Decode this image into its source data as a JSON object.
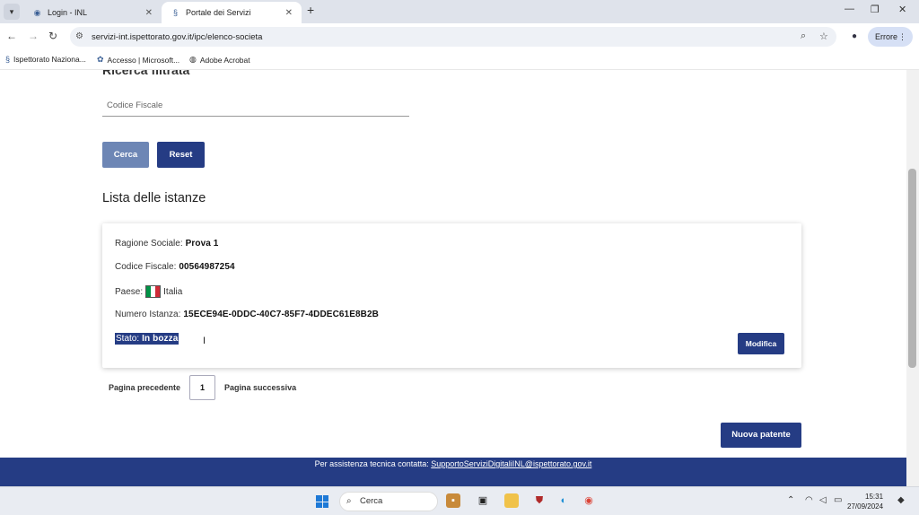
{
  "browser": {
    "tabs": [
      {
        "label": "Login - INL",
        "active": false
      },
      {
        "label": "Portale dei Servizi",
        "active": true
      }
    ],
    "url": "servizi-int.ispettorato.gov.it/ipc/elenco-societa",
    "profile_button": "Errore",
    "bookmarks": [
      {
        "label": "Ispettorato Naziona..."
      },
      {
        "label": "Accesso | Microsoft..."
      },
      {
        "label": "Adobe Acrobat"
      }
    ]
  },
  "search": {
    "section_title": "Ricerca filtrata",
    "codice_fiscale_placeholder": "Codice Fiscale",
    "cerca_label": "Cerca",
    "reset_label": "Reset"
  },
  "list": {
    "title": "Lista delle istanze",
    "items": [
      {
        "ragione_sociale_label": "Ragione Sociale:",
        "ragione_sociale": "Prova 1",
        "codice_fiscale_label": "Codice Fiscale:",
        "codice_fiscale": "00564987254",
        "paese_label": "Paese:",
        "paese": "Italia",
        "numero_istanza_label": "Numero Istanza:",
        "numero_istanza": "15ECE94E-0DDC-40C7-85F7-4DDEC61E8B2B",
        "stato_label": "Stato:",
        "stato": "In bozza",
        "modifica_label": "Modifica"
      }
    ]
  },
  "pagination": {
    "prev_label": "Pagina precedente",
    "current_page": "1",
    "next_label": "Pagina successiva"
  },
  "actions": {
    "nuova_patente_label": "Nuova patente"
  },
  "footer": {
    "text": "Per assistenza tecnica contatta:",
    "email": "SupportoServiziDigitaliINL@ispettorato.gov.it"
  },
  "taskbar": {
    "search_label": "Cerca",
    "time": "15:31",
    "date": "27/09/2024"
  },
  "colors": {
    "primary": "#253c84",
    "primary_light": "#6d86b5",
    "flag_green": "#009246",
    "flag_white": "#ffffff",
    "flag_red": "#ce2b37"
  }
}
